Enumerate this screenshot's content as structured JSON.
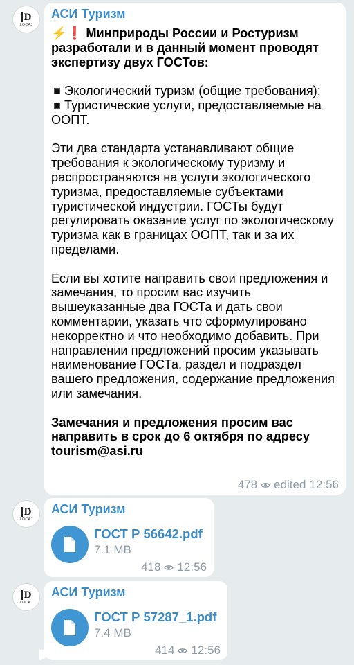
{
  "messages": [
    {
      "sender": "АСИ Туризм",
      "avatar_text": "LOCAJ",
      "avatar_letter": "D",
      "lines": {
        "intro_emoji": "⚡❗",
        "intro": "Минприроды России и Ростуризм разработали и в данный момент проводят экспертизу двух ГОСТов:",
        "item1": "Экологический туризм (общие требования);",
        "item2": "Туристические услуги, предоставляемые на ООПТ.",
        "para1": "Эти два стандарта устанавливают общие требования к экологическому туризму и распространяются на услуги экологического туризма, предоставляемые субъектами туристической индустрии. ГОСТы будут регулировать оказание услуг по экологическому туризма как в границах ООПТ, так и за их пределами.",
        "para2": "Если вы хотите направить свои предложения и замечания, то просим вас изучить вышеуказанные два ГОСТа и дать свои комментарии, указать что сформулировано некорректно и что необходимо добавить. При направлении предложений просим указывать наименование ГОСТа, раздел и подраздел вашего предложения, содержание предложения или замечания.",
        "closing": "Замечания и предложения просим вас направить в срок до 6 октября по адресу tourism@asi.ru"
      },
      "views": "478",
      "edited": "edited",
      "time": "12:56"
    },
    {
      "sender": "АСИ Туризм",
      "avatar_text": "LOCAJ",
      "avatar_letter": "D",
      "file_name": "ГОСТ Р 56642.pdf",
      "file_size": "7.1 MB",
      "views": "418",
      "time": "12:56"
    },
    {
      "sender": "АСИ Туризм",
      "avatar_text": "LOCAJ",
      "avatar_letter": "D",
      "file_name": "ГОСТ Р 57287_1.pdf",
      "file_size": "7.4 MB",
      "views": "414",
      "time": "12:56"
    }
  ],
  "colors": {
    "background": "#e6ebee",
    "bubble": "#ffffff",
    "accent": "#3a8bc8",
    "file_icon": "#3f96d3",
    "meta": "#8f9ba5"
  },
  "icons": [
    "eye-icon",
    "file-icon",
    "avatar-logo"
  ]
}
